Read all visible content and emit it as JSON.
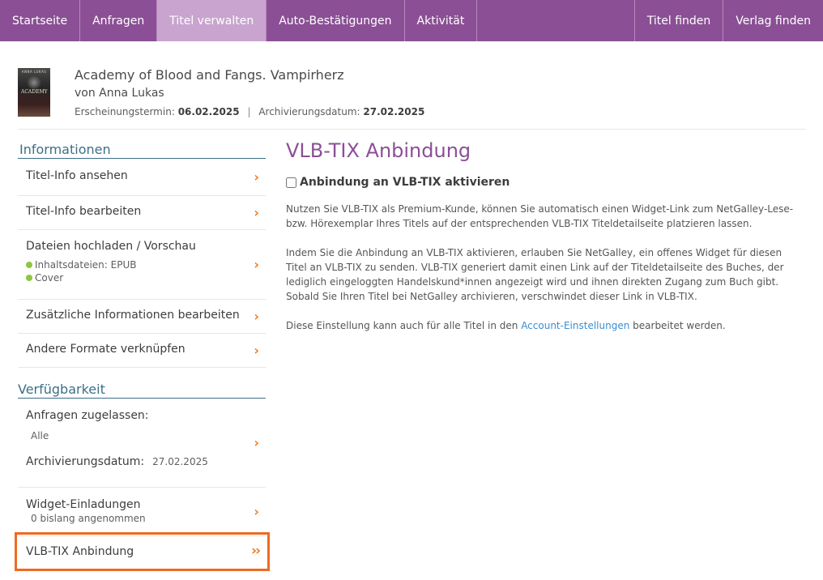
{
  "nav": {
    "left": [
      {
        "label": "Startseite",
        "active": false
      },
      {
        "label": "Anfragen",
        "active": false
      },
      {
        "label": "Titel verwalten",
        "active": true
      },
      {
        "label": "Auto-Bestätigungen",
        "active": false
      },
      {
        "label": "Aktivität",
        "active": false
      }
    ],
    "right": [
      {
        "label": "Titel finden"
      },
      {
        "label": "Verlag finden"
      }
    ]
  },
  "book": {
    "title": "Academy of Blood and Fangs. Vampirherz",
    "author": "von Anna Lukas",
    "release_label": "Erscheinungstermin:",
    "release_date": "06.02.2025",
    "separator": "|",
    "archive_label": "Archivierungsdatum:",
    "archive_date": "27.02.2025",
    "cover": {
      "top_text": "ANNA LUKAS",
      "mid_text": "ACADEMY"
    }
  },
  "sidebar": {
    "info_title": "Informationen",
    "info_items": {
      "view": "Titel-Info ansehen",
      "edit": "Titel-Info bearbeiten",
      "upload": "Dateien hochladen / Vorschau",
      "upload_sub1": "Inhaltsdateien: EPUB",
      "upload_sub2": "Cover",
      "extra": "Zusätzliche Informationen bearbeiten",
      "formats": "Andere Formate verknüpfen"
    },
    "avail_title": "Verfügbarkeit",
    "avail": {
      "requests_label": "Anfragen zugelassen:",
      "requests_value": "Alle",
      "archive_label": "Archivierungsdatum:",
      "archive_value": "27.02.2025",
      "widget_label": "Widget-Einladungen",
      "widget_sub": "0 bislang angenommen",
      "vlb_label": "VLB-TIX Anbindung"
    },
    "chevron": "›",
    "double_chevron": "››"
  },
  "main": {
    "heading": "VLB-TIX Anbindung",
    "checkbox_label": "Anbindung an VLB-TIX aktivieren",
    "para1": "Nutzen Sie VLB-TIX als Premium-Kunde, können Sie automatisch einen Widget-Link zum NetGalley-Lese- bzw. Hörexemplar Ihres Titels auf der entsprechenden VLB-TIX Titeldetailseite platzieren lassen.",
    "para2": "Indem Sie die Anbindung an VLB-TIX aktivieren, erlauben Sie NetGalley, ein offenes Widget für diesen Titel an VLB-TIX zu senden. VLB-TIX generiert damit einen Link auf der Titeldetailseite des Buches, der lediglich eingeloggten Handelskund*innen angezeigt wird und ihnen direkten Zugang zum Buch gibt. Sobald Sie Ihren Titel bei NetGalley archivieren, verschwindet dieser Link in VLB-TIX.",
    "para3_before": "Diese Einstellung kann auch für alle Titel in den",
    "para3_link": "Account-Einstellungen",
    "para3_after": "bearbeitet werden."
  },
  "colors": {
    "nav_bg": "#8b4f95",
    "nav_active": "#c9a4cf",
    "heading": "#8b4f95",
    "section_title": "#3d6f86",
    "chevron": "#ef7c24",
    "highlight_border": "#ef6a1f",
    "status_dot": "#8dc63f",
    "link": "#3a8ed1"
  }
}
